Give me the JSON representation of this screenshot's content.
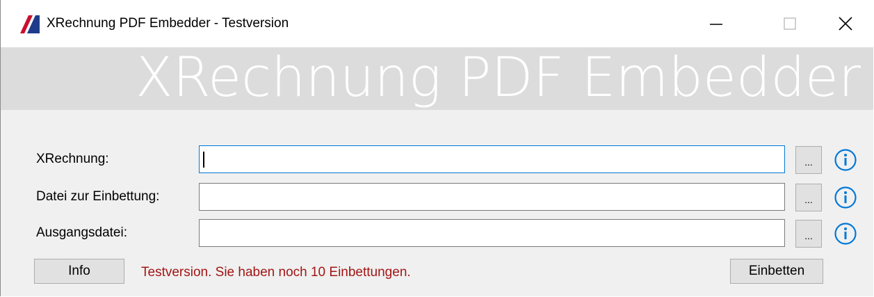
{
  "window": {
    "title": "XRechnung PDF Embedder - Testversion",
    "icon": "app-logo-icon",
    "controls": [
      "minimize-icon",
      "maximize-icon",
      "close-icon"
    ]
  },
  "banner": {
    "text": "XRechnung PDF Embedder"
  },
  "form": {
    "rows": [
      {
        "label": "XRechnung:",
        "value": "",
        "browse_label": "...",
        "info_icon": "info-icon"
      },
      {
        "label": "Datei zur Einbettung:",
        "value": "",
        "browse_label": "...",
        "info_icon": "info-icon"
      },
      {
        "label": "Ausgangsdatei:",
        "value": "",
        "browse_label": "...",
        "info_icon": "info-icon"
      }
    ]
  },
  "footer": {
    "info_button": "Info",
    "status": "Testversion. Sie haben noch 10 Einbettungen.",
    "embed_button": "Einbetten"
  },
  "colors": {
    "accent": "#0078d7",
    "status_text": "#a31515",
    "banner_bg": "#dcdcdc",
    "logo_red": "#c8102e",
    "logo_blue": "#1f3c8c"
  }
}
